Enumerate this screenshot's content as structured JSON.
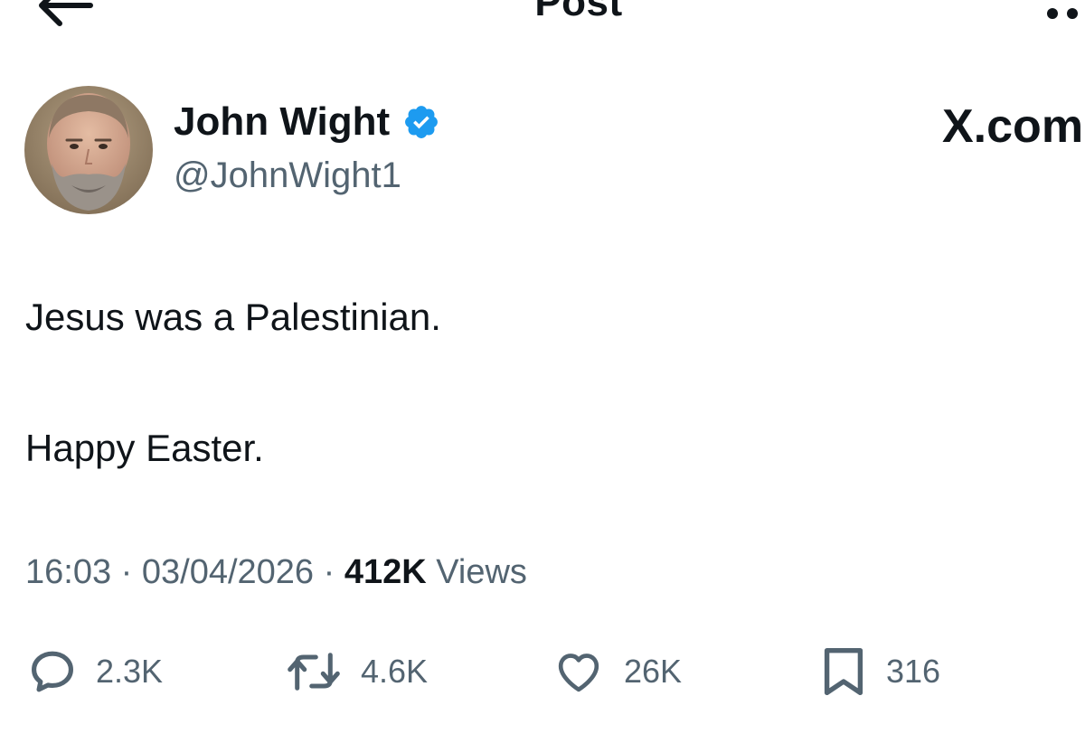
{
  "header": {
    "title": "Post",
    "back_icon": "arrow-left-icon",
    "more_icon": "more-dots-icon"
  },
  "author": {
    "name": "John Wight",
    "handle": "@JohnWight1",
    "verified": true,
    "verified_color": "#1d9bf0"
  },
  "source_mark": "X.com",
  "post": {
    "lines": [
      "Jesus was a Palestinian.",
      "Happy Easter."
    ]
  },
  "meta": {
    "time": "16:03",
    "separator": "·",
    "date": "03/04/2026",
    "views_count": "412K",
    "views_label": "Views"
  },
  "actions": {
    "reply": {
      "count": "2.3K",
      "icon": "reply-bubble-icon"
    },
    "repost": {
      "count": "4.6K",
      "icon": "repost-icon"
    },
    "like": {
      "count": "26K",
      "icon": "heart-icon"
    },
    "bookmark": {
      "count": "316",
      "icon": "bookmark-icon"
    }
  },
  "colors": {
    "text_primary": "#0f1419",
    "text_secondary": "#536471",
    "accent": "#1d9bf0"
  }
}
